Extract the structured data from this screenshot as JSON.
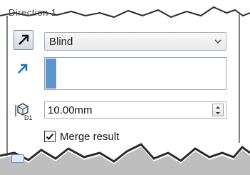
{
  "header_fragment": "Direction 1",
  "direction": {
    "end_condition": "Blind"
  },
  "depth": {
    "value": "10.00mm"
  },
  "merge_result": {
    "label": "Merge result",
    "checked": true
  },
  "icons": {
    "reverse": "reverse-direction-icon",
    "direction": "direction-arrow-icon",
    "depth": "depth-d1-icon",
    "dropdown": "chevron-down-icon",
    "spinner": "spinner-icon",
    "check": "checkmark-icon"
  },
  "colors": {
    "selection": "#5d95d1",
    "panel_border": "#9aa3ad",
    "frame_edge": "#2b2b2b"
  }
}
